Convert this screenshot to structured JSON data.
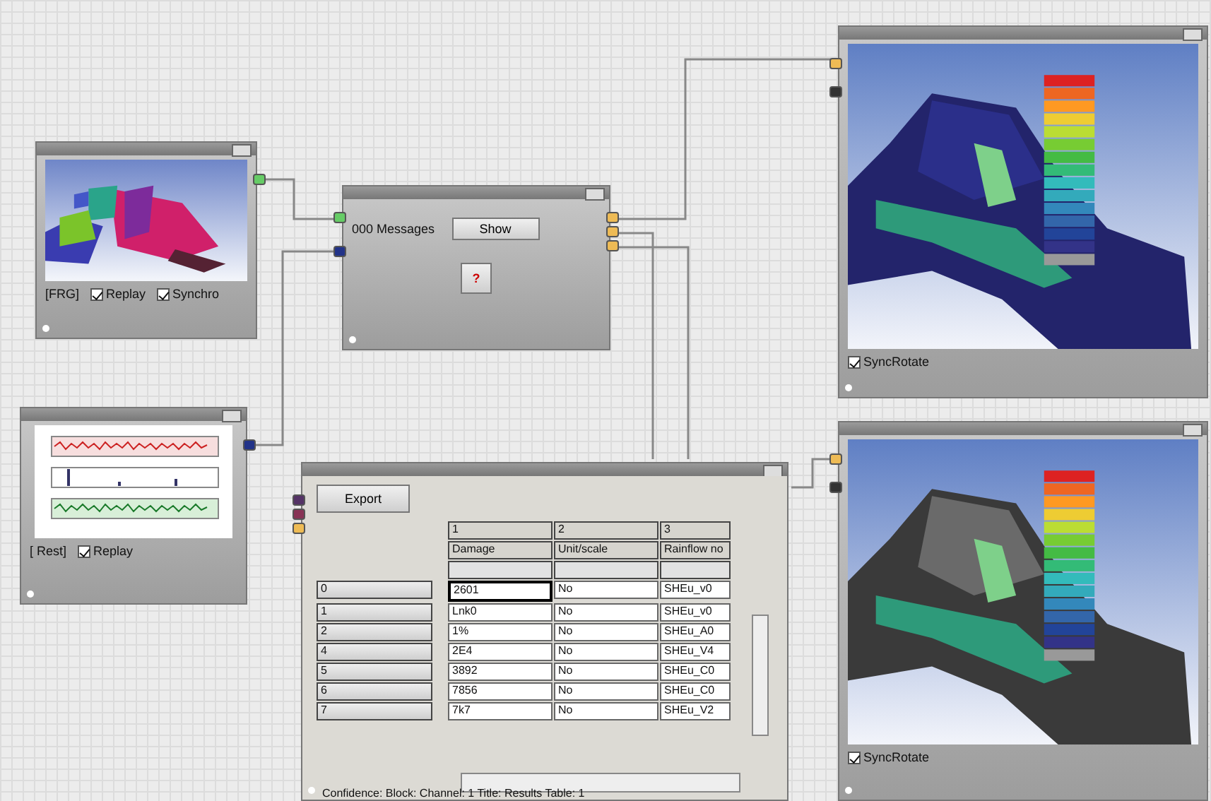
{
  "nodes": [
    {
      "kind": "viewer-small",
      "label": "[FRG]",
      "checks": [
        {
          "label": "Replay",
          "checked": true
        },
        {
          "label": "Synchro",
          "checked": true
        }
      ]
    },
    {
      "kind": "messages",
      "label": "000 Messages",
      "button": "Show",
      "help": "?"
    },
    {
      "kind": "signals",
      "label": "[ Rest]",
      "checks": [
        {
          "label": "Replay",
          "checked": true
        }
      ]
    },
    {
      "kind": "table",
      "button": "Export",
      "columns": [
        "1",
        "2",
        "3"
      ],
      "header_row": [
        "Damage",
        "Unit/scale",
        "Rainflow no"
      ],
      "row_headers": [
        "0",
        "1",
        "2",
        "4",
        "5",
        "6",
        "7"
      ],
      "rows": [
        [
          "2601",
          "No",
          "SHEu_v0"
        ],
        [
          "Lnk0",
          "No",
          "SHEu_v0"
        ],
        [
          "1%",
          "No",
          "SHEu_A0"
        ],
        [
          "2E4",
          "No",
          "SHEu_V4"
        ],
        [
          "3892",
          "No",
          "SHEu_C0"
        ],
        [
          "7856",
          "No",
          "SHEu_C0"
        ],
        [
          "7k7",
          "No",
          "SHEu_V2"
        ]
      ],
      "status": "Confidence: Block: Channel: 1 Title: Results Table: 1"
    },
    {
      "kind": "viewer",
      "checks": [
        {
          "label": "SyncRotate",
          "checked": true
        }
      ]
    },
    {
      "kind": "viewer",
      "checks": [
        {
          "label": "SyncRotate",
          "checked": true
        }
      ]
    }
  ]
}
